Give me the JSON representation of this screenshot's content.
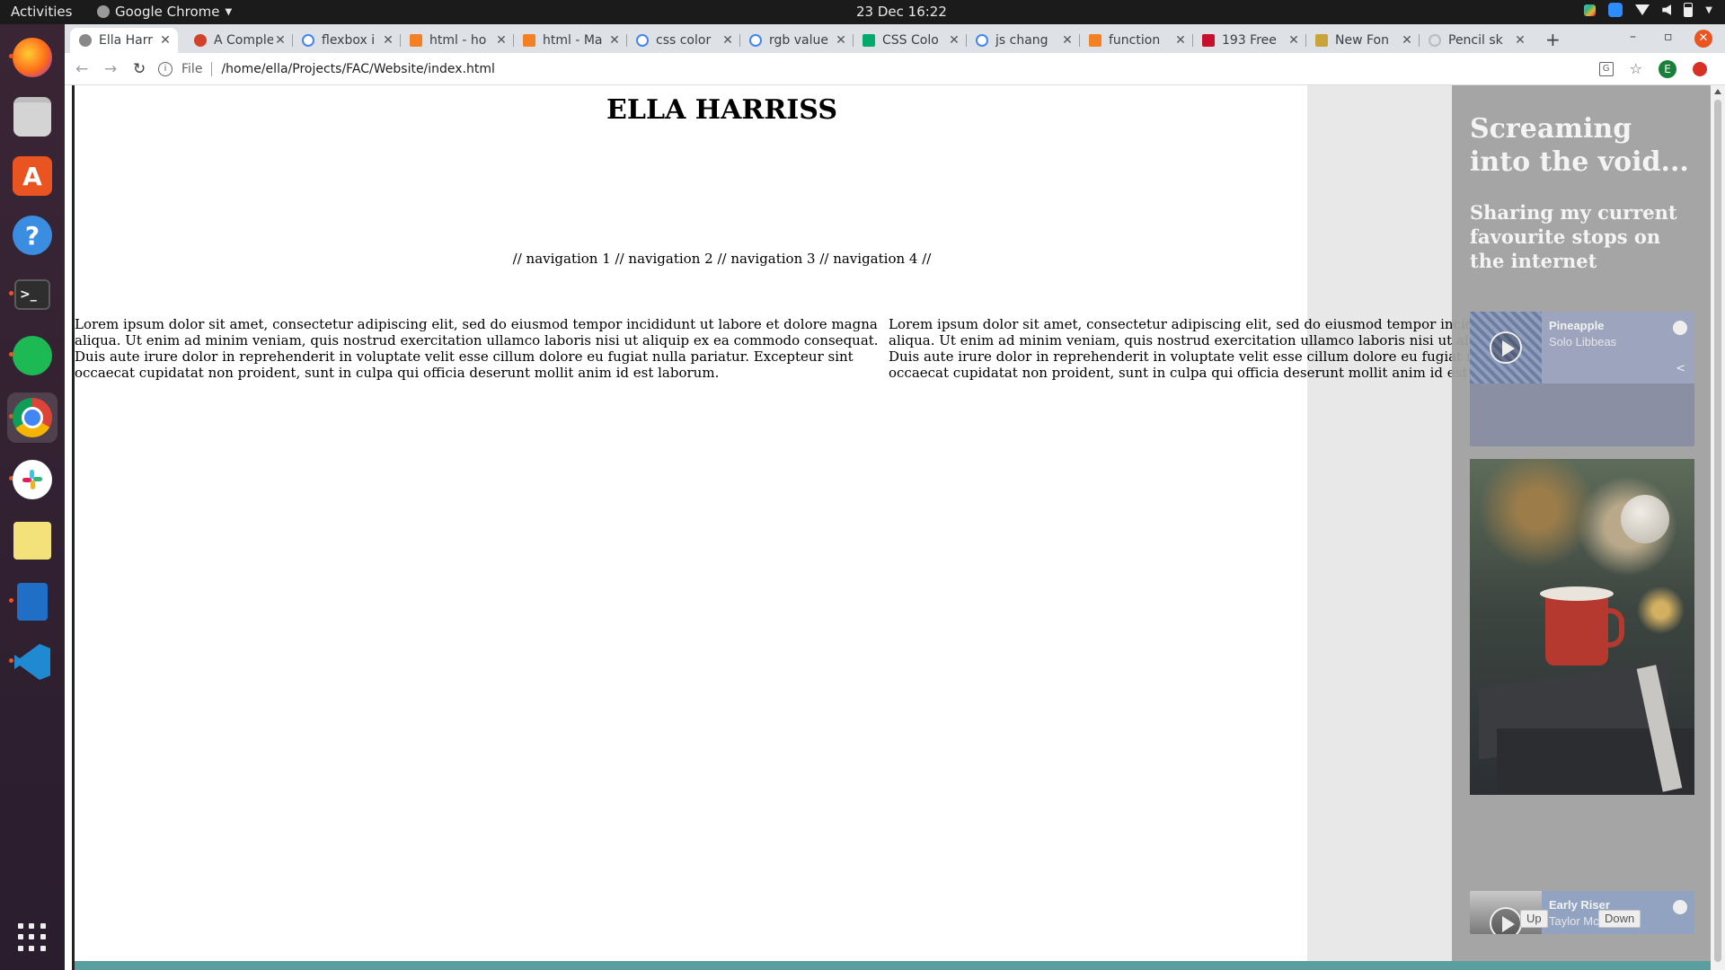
{
  "os_topbar": {
    "activities": "Activities",
    "app_name": "Google Chrome",
    "clock": "23 Dec  16:22"
  },
  "dock": {
    "items": [
      "firefox-icon",
      "files-icon",
      "software-icon",
      "help-icon",
      "terminal-icon",
      "spotify-icon",
      "chrome-icon",
      "slack-icon",
      "notes-icon",
      "writer-icon",
      "vscode-icon"
    ]
  },
  "browser": {
    "tabs": [
      {
        "label": "Ella Harr",
        "icon": "globe-icon",
        "active": true
      },
      {
        "label": "A Comple",
        "icon": "css-tricks-icon"
      },
      {
        "label": "flexbox i",
        "icon": "google-icon"
      },
      {
        "label": "html - ho",
        "icon": "stackoverflow-icon"
      },
      {
        "label": "html - Ma",
        "icon": "stackoverflow-icon"
      },
      {
        "label": "css color",
        "icon": "google-icon"
      },
      {
        "label": "rgb value",
        "icon": "google-icon"
      },
      {
        "label": "CSS Colo",
        "icon": "w3schools-icon"
      },
      {
        "label": "js chang",
        "icon": "google-icon"
      },
      {
        "label": "function",
        "icon": "stackoverflow-icon"
      },
      {
        "label": "193 Free",
        "icon": "fontsquirrel-icon"
      },
      {
        "label": "New Fon",
        "icon": "fonts-icon"
      },
      {
        "label": "Pencil sk",
        "icon": "loading-icon"
      }
    ],
    "address": {
      "scheme_label": "File",
      "url": "/home/ella/Projects/FAC/Website/index.html"
    },
    "profile_initial": "E"
  },
  "page": {
    "title": "ELLA HARRISS",
    "nav": "// navigation 1 // navigation 2 // navigation 3 // navigation 4 //",
    "columns": [
      "Lorem ipsum dolor sit amet, consectetur adipiscing elit, sed do eiusmod tempor incididunt ut labore et dolore magna aliqua. Ut enim ad minim veniam, quis nostrud exercitation ullamco laboris nisi ut aliquip ex ea commodo consequat. Duis aute irure dolor in reprehenderit in voluptate velit esse cillum dolore eu fugiat nulla pariatur. Excepteur sint occaecat cupidatat non proident, sunt in culpa qui officia deserunt mollit anim id est laborum.",
      "Lorem ipsum dolor sit amet, consectetur adipiscing elit, sed do eiusmod tempor incididunt ut labore et dolore magna aliqua. Ut enim ad minim veniam, quis nostrud exercitation ullamco laboris nisi ut aliquip ex ea commodo consequat. Duis aute irure dolor in reprehenderit in voluptate velit esse cillum dolore eu fugiat nulla pariatur. Excepteur sint occaecat cupidatat non proident, sunt in culpa qui officia deserunt mollit anim id est laborum."
    ],
    "sidebar": {
      "title": "Screaming into the void...",
      "subtitle": "Sharing my current favourite stops on the internet",
      "players": [
        {
          "track": "Pineapple",
          "artist": "Solo Libbeas"
        },
        {
          "track": "Early Riser",
          "artist": "Taylor McFerrin"
        }
      ],
      "up_label": "Up",
      "down_label": "Down"
    }
  },
  "colors": {
    "footer_accent": "#5a9ea0",
    "sidebar_overlay": "#a0a0a0",
    "close_button": "#e95420"
  }
}
